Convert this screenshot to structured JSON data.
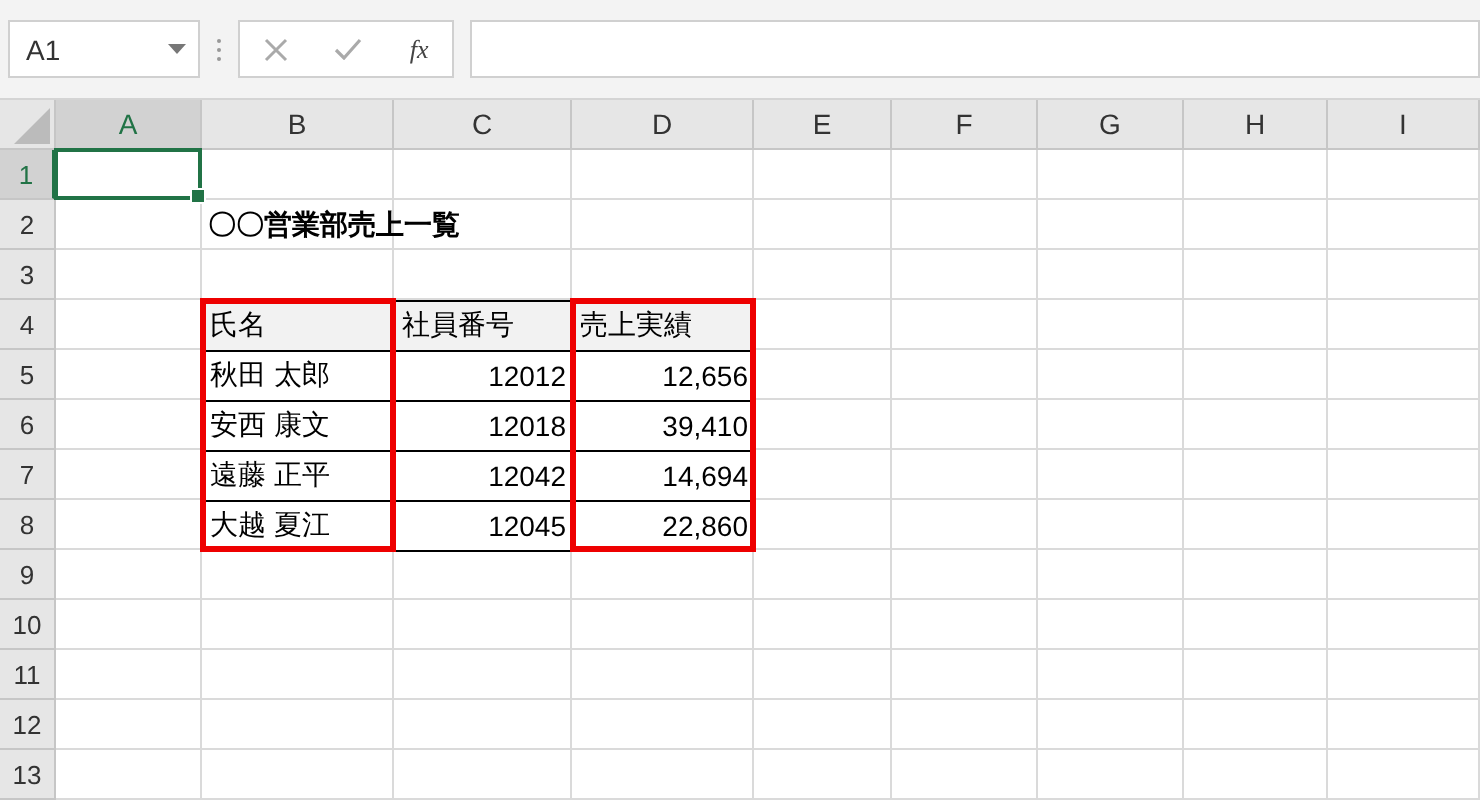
{
  "name_box": {
    "value": "A1"
  },
  "formula_bar": {
    "function_label": "fx"
  },
  "sheet": {
    "columns": [
      {
        "label": "A",
        "selected": true
      },
      {
        "label": "B",
        "selected": false
      },
      {
        "label": "C",
        "selected": false
      },
      {
        "label": "D",
        "selected": false
      },
      {
        "label": "E",
        "selected": false
      },
      {
        "label": "F",
        "selected": false
      },
      {
        "label": "G",
        "selected": false
      },
      {
        "label": "H",
        "selected": false
      },
      {
        "label": "I",
        "selected": false
      }
    ],
    "rows": [
      {
        "label": "1",
        "selected": true
      },
      {
        "label": "2",
        "selected": false
      },
      {
        "label": "3",
        "selected": false
      },
      {
        "label": "4",
        "selected": false
      },
      {
        "label": "5",
        "selected": false
      },
      {
        "label": "6",
        "selected": false
      },
      {
        "label": "7",
        "selected": false
      },
      {
        "label": "8",
        "selected": false
      },
      {
        "label": "9",
        "selected": false
      },
      {
        "label": "10",
        "selected": false
      },
      {
        "label": "11",
        "selected": false
      },
      {
        "label": "12",
        "selected": false
      },
      {
        "label": "13",
        "selected": false
      }
    ]
  },
  "title": "〇〇営業部売上一覧",
  "table": {
    "columns": [
      {
        "label": "氏名",
        "kind": "text",
        "highlighted": true
      },
      {
        "label": "社員番号",
        "kind": "number",
        "highlighted": false
      },
      {
        "label": "売上実績",
        "kind": "number",
        "highlighted": true
      }
    ],
    "rows": [
      [
        "秋田 太郎",
        "12012",
        "12,656"
      ],
      [
        "安西 康文",
        "12018",
        "39,410"
      ],
      [
        "遠藤 正平",
        "12042",
        "14,694"
      ],
      [
        "大越 夏江",
        "12045",
        "22,860"
      ]
    ]
  }
}
